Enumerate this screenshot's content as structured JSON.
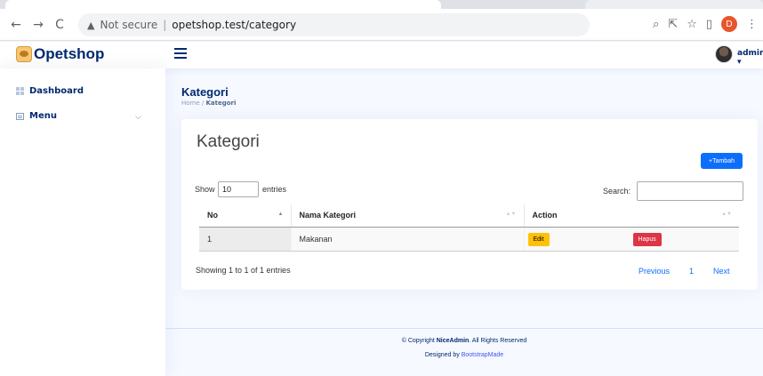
{
  "browser": {
    "security_text": "Not secure",
    "url": "opetshop.test/category",
    "profile_initial": "D"
  },
  "app": {
    "logo_text": "Opetshop",
    "user_name": "admin",
    "brand_color": "#012970",
    "accent_color": "#4154f1"
  },
  "sidebar": {
    "items": [
      {
        "label": "Dashboard",
        "icon": "grid-icon"
      },
      {
        "label": "Menu",
        "icon": "menu-icon",
        "expandable": true
      }
    ]
  },
  "page": {
    "title": "Kategori",
    "breadcrumb_home": "Home",
    "breadcrumb_sep": "/",
    "breadcrumb_current": "Kategori"
  },
  "card": {
    "title": "Kategori",
    "add_button": "+Tambah",
    "show_label": "Show",
    "show_value": "10",
    "entries_label": "entries",
    "search_label": "Search:",
    "search_value": "",
    "columns": [
      "No",
      "Nama Kategori",
      "Action"
    ],
    "rows": [
      {
        "no": "1",
        "nama": "Makanan",
        "edit": "Edit",
        "hapus": "Hapus"
      }
    ],
    "info": "Showing 1 to 1 of 1 entries",
    "pagination": {
      "previous": "Previous",
      "page": "1",
      "next": "Next"
    }
  },
  "footer": {
    "copyright_prefix": "© Copyright",
    "brand": "NiceAdmin",
    "copyright_suffix": ". All Rights Reserved",
    "designed_by": "Designed by",
    "designer": "BootstrapMade"
  }
}
